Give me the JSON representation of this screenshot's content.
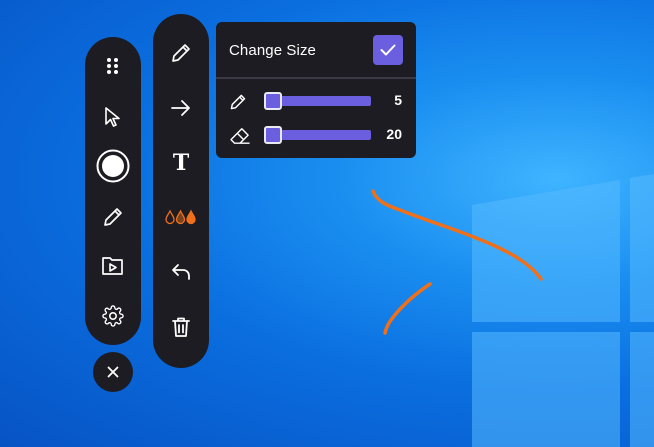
{
  "colors": {
    "toolbar_bg": "#1c1c22",
    "accent": "#6b5fe0",
    "ink_orange": "#f0701a",
    "icon_white": "#ffffff"
  },
  "main_toolbar": {
    "items": [
      {
        "icon": "drag-handle-icon"
      },
      {
        "icon": "cursor-icon"
      },
      {
        "icon": "record-icon"
      },
      {
        "icon": "pen-icon"
      },
      {
        "icon": "video-folder-icon"
      },
      {
        "icon": "gear-icon"
      }
    ]
  },
  "close_button": {
    "icon": "close-icon"
  },
  "secondary_toolbar": {
    "items": [
      {
        "icon": "pen-icon"
      },
      {
        "icon": "arrow-icon"
      },
      {
        "icon": "text-icon",
        "glyph": "T"
      },
      {
        "icon": "color-drops-icon"
      },
      {
        "icon": "undo-icon"
      },
      {
        "icon": "trash-icon"
      }
    ]
  },
  "size_panel": {
    "title": "Change Size",
    "pen": {
      "value": "5",
      "level": 0.0
    },
    "eraser": {
      "value": "20",
      "level": 0.0
    }
  }
}
